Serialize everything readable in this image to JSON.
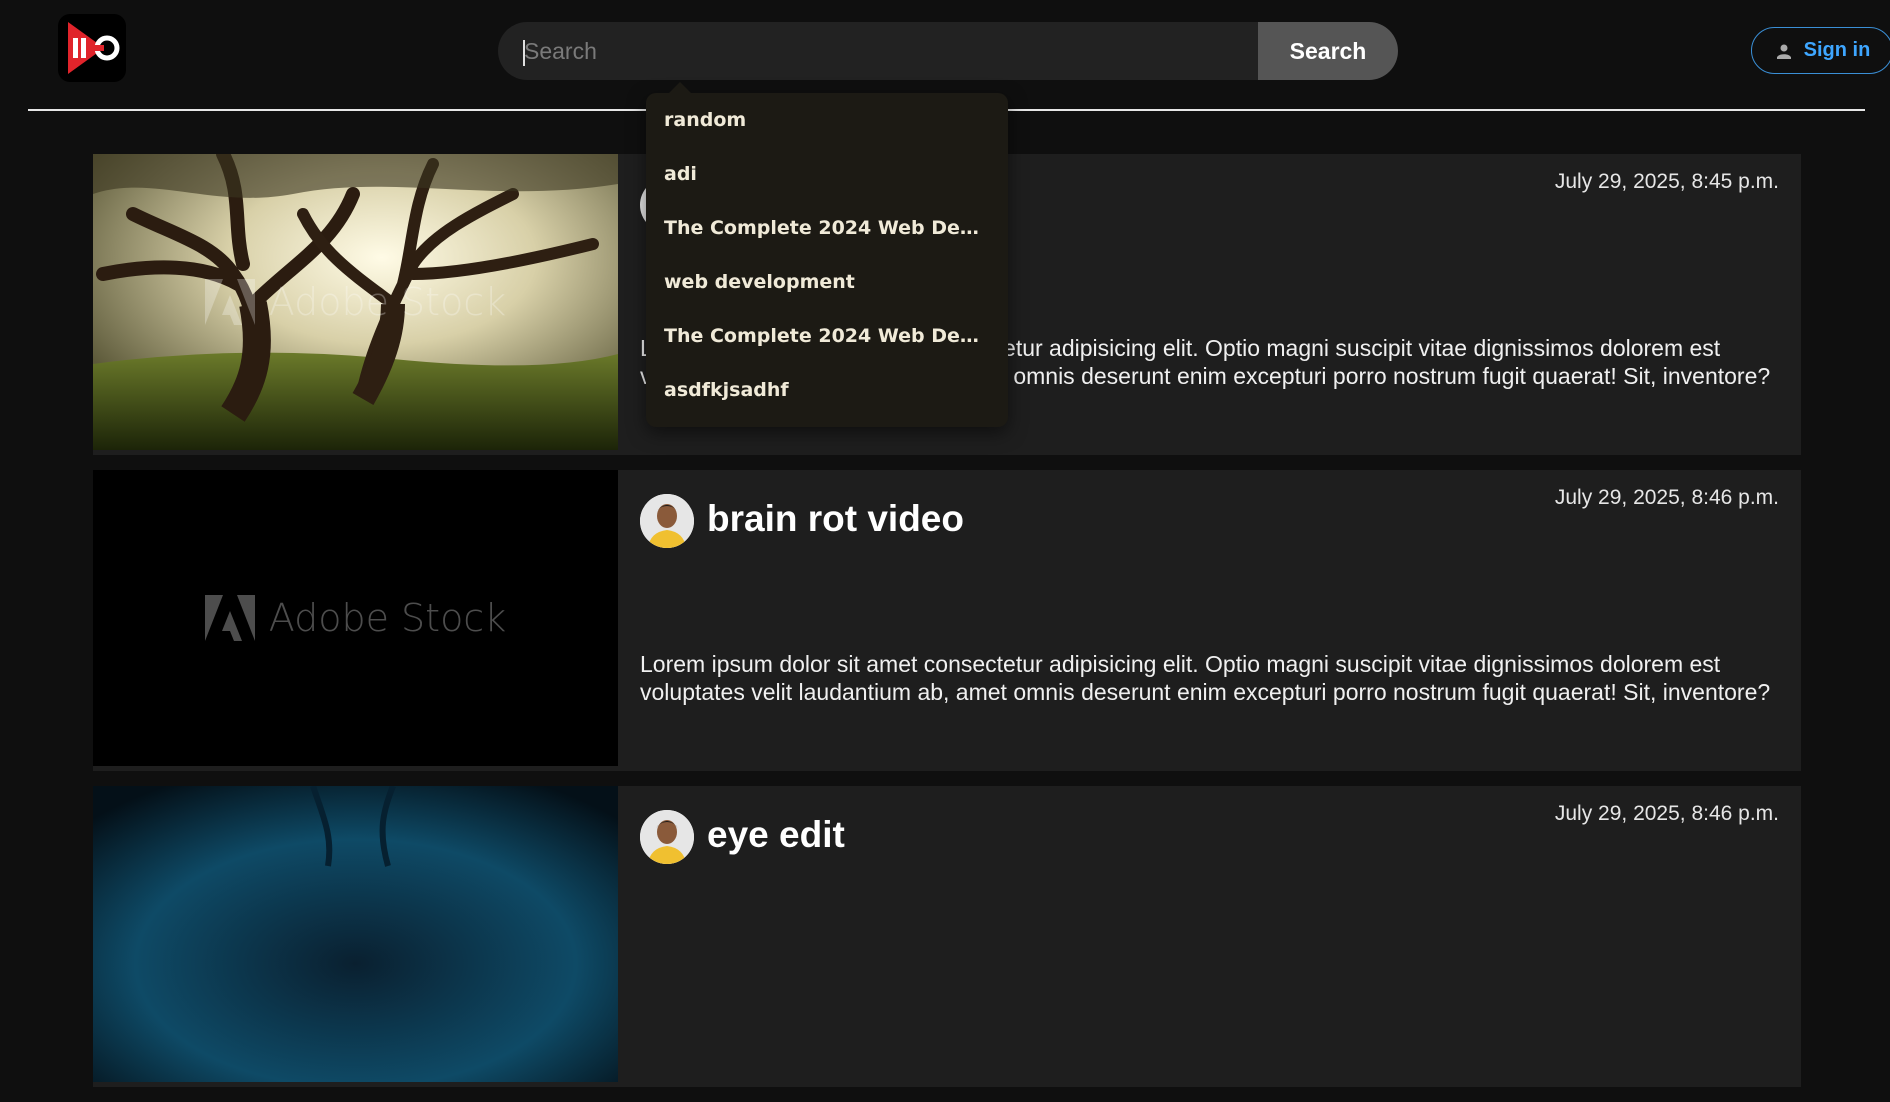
{
  "header": {
    "logo_icon": "app-logo-icon",
    "search": {
      "placeholder": "Search",
      "value": ""
    },
    "search_button_label": "Search",
    "signin_label": "Sign in",
    "accent_color": "#3ea6ff"
  },
  "search_suggestions": [
    {
      "label": "random"
    },
    {
      "label": "adi"
    },
    {
      "label": "The Complete 2024 Web Deve..."
    },
    {
      "label": "web development"
    },
    {
      "label": "The Complete 2024 Web Deve..."
    },
    {
      "label": "asdfkjsadhf"
    }
  ],
  "videos": [
    {
      "title": "",
      "date": "July 29, 2025, 8:45 p.m.",
      "description": "Lorem ipsum dolor sit amet consectetur adipisicing elit. Optio magni suscipit vitae dignissimos dolorem est voluptates velit laudantium ab, amet omnis deserunt enim excepturi porro nostrum fugit quaerat! Sit, inventore?",
      "watermark": "Adobe Stock"
    },
    {
      "title": "brain rot video",
      "date": "July 29, 2025, 8:46 p.m.",
      "description": "Lorem ipsum dolor sit amet consectetur adipisicing elit. Optio magni suscipit vitae dignissimos dolorem est voluptates velit laudantium ab, amet omnis deserunt enim excepturi porro nostrum fugit quaerat! Sit, inventore?",
      "watermark": "Adobe Stock"
    },
    {
      "title": "eye edit",
      "date": "July 29, 2025, 8:46 p.m."
    }
  ]
}
